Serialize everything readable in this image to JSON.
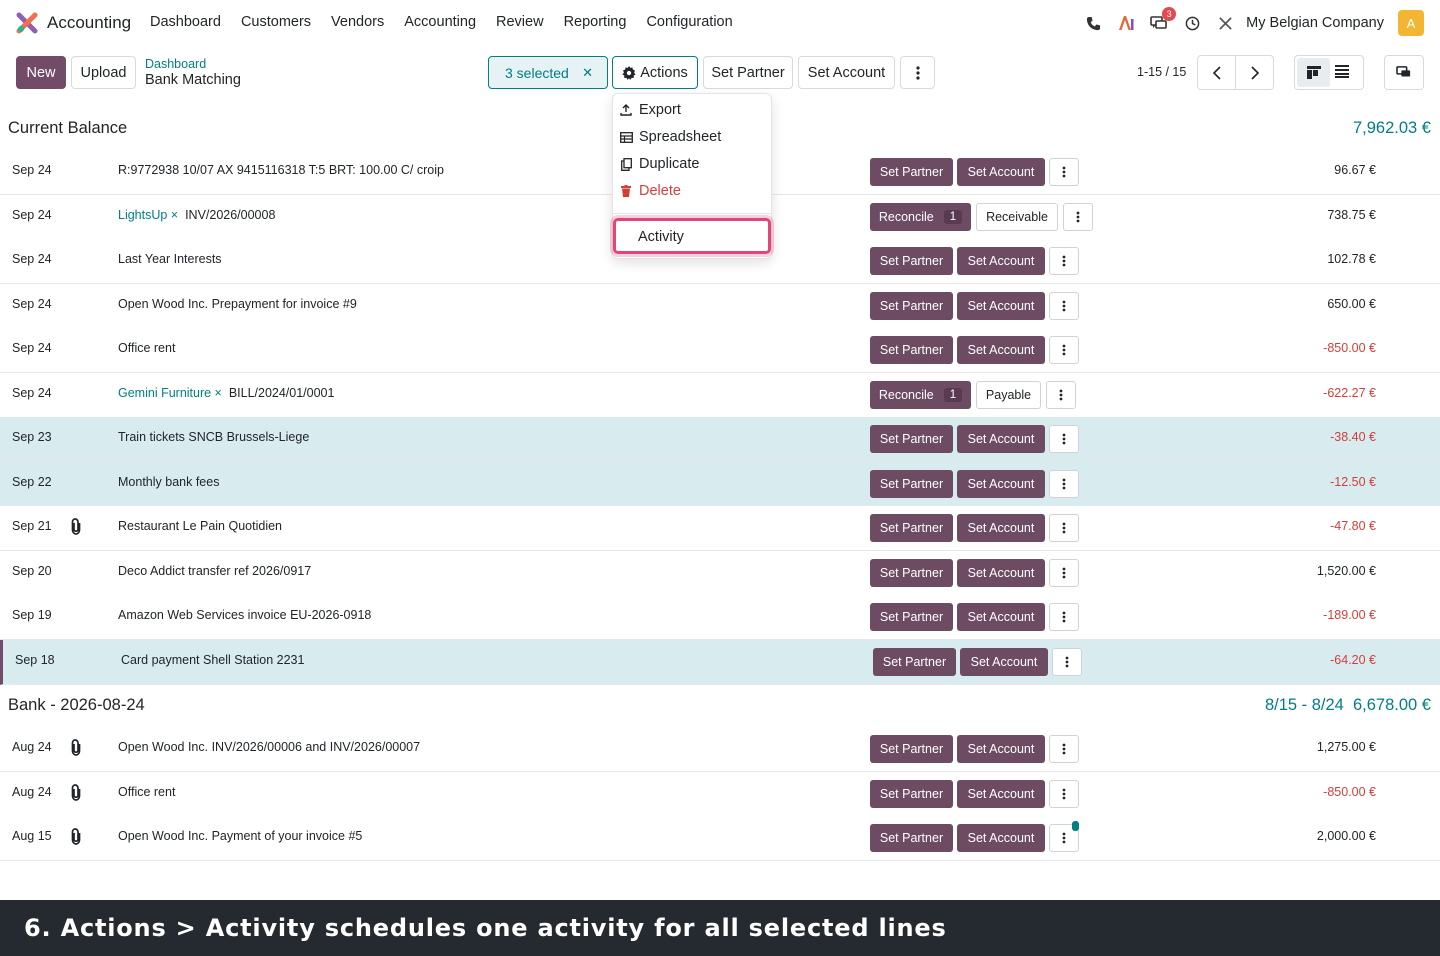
{
  "app": {
    "name": "Accounting"
  },
  "menu": [
    "Dashboard",
    "Customers",
    "Vendors",
    "Accounting",
    "Review",
    "Reporting",
    "Configuration"
  ],
  "systray": {
    "messages_badge": "3",
    "company": "My Belgian Company",
    "avatar_letter": "A"
  },
  "control": {
    "new_label": "New",
    "upload_label": "Upload",
    "breadcrumb_parent": "Dashboard",
    "breadcrumb_current": "Bank Matching",
    "selected_label": "3 selected",
    "actions_label": "Actions",
    "set_partner_label": "Set Partner",
    "set_account_label": "Set Account",
    "pager": "1-15 / 15"
  },
  "actions_menu": {
    "items": [
      "Export",
      "Spreadsheet",
      "Duplicate",
      "Delete"
    ],
    "activity": "Activity"
  },
  "sections": {
    "current": {
      "title": "Current Balance",
      "amount": "7,962.03 €"
    },
    "bank": {
      "title": "Bank - 2026-08-24",
      "range": "8/15 - 8/24",
      "amount": "6,678.00 €"
    }
  },
  "buttons": {
    "set_partner": "Set Partner",
    "set_account": "Set Account",
    "reconcile": "Reconcile",
    "reconcile_count": "1",
    "receivable": "Receivable",
    "payable": "Payable"
  },
  "rows": [
    {
      "date": "Sep 24",
      "partner": "",
      "label": "R:9772938 10/07 AX 9415116318 T:5 BRT: 100.00 C/ croip",
      "amount": "96.67 €"
    },
    {
      "date": "Sep 24",
      "partner": "LightsUp ×",
      "label": "INV/2026/00008",
      "amount": "738.75 €"
    },
    {
      "date": "Sep 24",
      "partner": "",
      "label": "Last Year Interests",
      "amount": "102.78 €"
    },
    {
      "date": "Sep 24",
      "partner": "",
      "label": "Open Wood Inc. Prepayment for invoice #9",
      "amount": "650.00 €"
    },
    {
      "date": "Sep 24",
      "partner": "",
      "label": "Office rent",
      "amount": "-850.00 €"
    },
    {
      "date": "Sep 24",
      "partner": "Gemini Furniture ×",
      "label": "BILL/2024/01/0001",
      "amount": "-622.27 €"
    },
    {
      "date": "Sep 23",
      "partner": "",
      "label": "Train tickets SNCB Brussels-Liege",
      "amount": "-38.40 €"
    },
    {
      "date": "Sep 22",
      "partner": "",
      "label": "Monthly bank fees",
      "amount": "-12.50 €"
    },
    {
      "date": "Sep 21",
      "partner": "",
      "label": "Restaurant Le Pain Quotidien",
      "amount": "-47.80 €"
    },
    {
      "date": "Sep 20",
      "partner": "",
      "label": "Deco Addict transfer ref 2026/0917",
      "amount": "1,520.00 €"
    },
    {
      "date": "Sep 19",
      "partner": "",
      "label": "Amazon Web Services invoice EU-2026-0918",
      "amount": "-189.00 €"
    },
    {
      "date": "Sep 18",
      "partner": "",
      "label": "Card payment Shell Station 2231",
      "amount": "-64.20 €"
    },
    {
      "date": "Aug 24",
      "partner": "",
      "label": "Open Wood Inc. INV/2026/00006 and INV/2026/00007",
      "amount": "1,275.00 €"
    },
    {
      "date": "Aug 24",
      "partner": "",
      "label": "Office rent",
      "amount": "-850.00 €"
    },
    {
      "date": "Aug 15",
      "partner": "",
      "label": "Open Wood Inc. Payment of your invoice #5",
      "amount": "2,000.00 €"
    }
  ],
  "caption": "6. Actions > Activity schedules one activity for all selected lines"
}
